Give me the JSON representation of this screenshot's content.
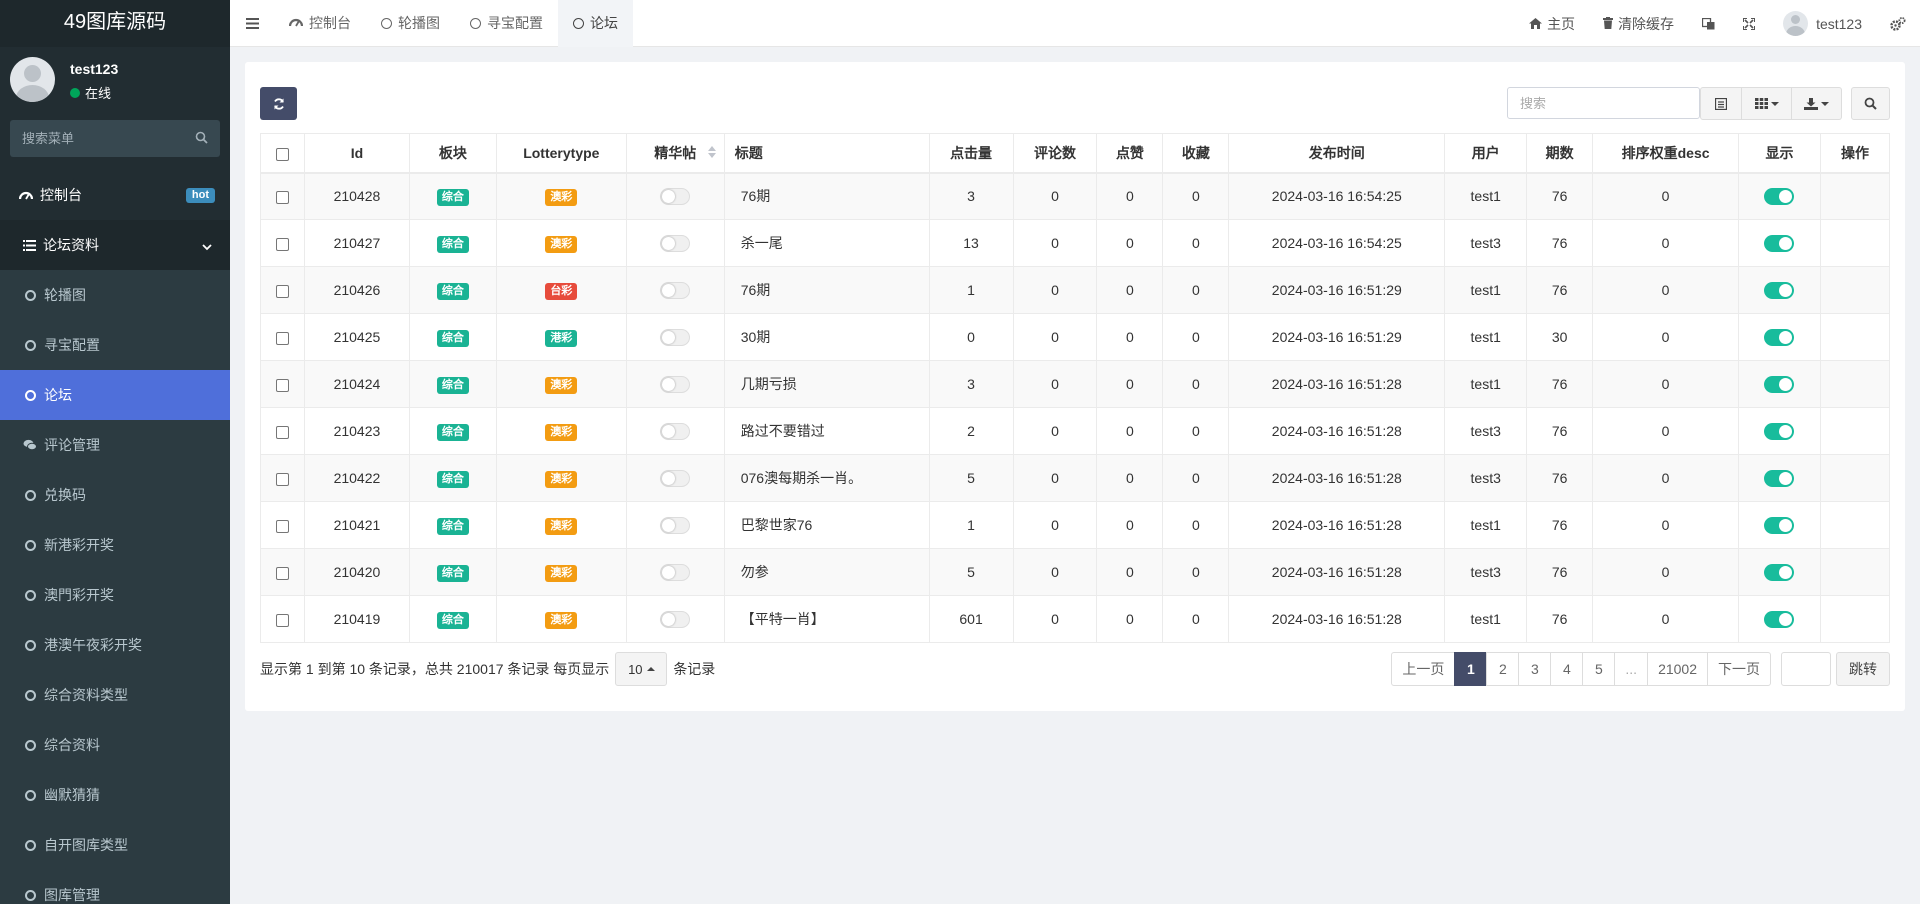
{
  "sidebar": {
    "logo": "49图库源码",
    "user_name": "test123",
    "user_status": "在线",
    "search_placeholder": "搜索菜单",
    "dashboard": "控制台",
    "hot_badge": "hot",
    "forum_group": "论坛资料",
    "items": [
      "轮播图",
      "寻宝配置",
      "论坛",
      "评论管理",
      "兑换码",
      "新港彩开奖",
      "澳門彩开奖",
      "港澳午夜彩开奖",
      "综合资料类型",
      "综合资料",
      "幽默猜猜",
      "自开图库类型",
      "图库管理"
    ],
    "active_item": "论坛"
  },
  "header": {
    "tabs": [
      "控制台",
      "轮播图",
      "寻宝配置",
      "论坛"
    ],
    "active_tab": "论坛",
    "home": "主页",
    "clear_cache": "清除缓存",
    "user": "test123"
  },
  "toolbar": {
    "search_placeholder": "搜索"
  },
  "table": {
    "columns": [
      "Id",
      "板块",
      "Lotterytype",
      "精华帖",
      "标题",
      "点击量",
      "评论数",
      "点赞",
      "收藏",
      "发布时间",
      "用户",
      "期数",
      "排序权重desc",
      "显示",
      "操作"
    ],
    "rows": [
      {
        "id": "210428",
        "section": "综合",
        "lottery": "澳彩",
        "lottery_color": "orange",
        "title": "76期",
        "clicks": "3",
        "comments": "0",
        "likes": "0",
        "favs": "0",
        "time": "2024-03-16 16:54:25",
        "user": "test1",
        "issue": "76",
        "weight": "0"
      },
      {
        "id": "210427",
        "section": "综合",
        "lottery": "澳彩",
        "lottery_color": "orange",
        "title": "杀一尾",
        "clicks": "13",
        "comments": "0",
        "likes": "0",
        "favs": "0",
        "time": "2024-03-16 16:54:25",
        "user": "test3",
        "issue": "76",
        "weight": "0"
      },
      {
        "id": "210426",
        "section": "综合",
        "lottery": "台彩",
        "lottery_color": "red",
        "title": "76期",
        "clicks": "1",
        "comments": "0",
        "likes": "0",
        "favs": "0",
        "time": "2024-03-16 16:51:29",
        "user": "test1",
        "issue": "76",
        "weight": "0"
      },
      {
        "id": "210425",
        "section": "综合",
        "lottery": "港彩",
        "lottery_color": "green",
        "title": "30期",
        "clicks": "0",
        "comments": "0",
        "likes": "0",
        "favs": "0",
        "time": "2024-03-16 16:51:29",
        "user": "test1",
        "issue": "30",
        "weight": "0"
      },
      {
        "id": "210424",
        "section": "综合",
        "lottery": "澳彩",
        "lottery_color": "orange",
        "title": "几期亏损",
        "clicks": "3",
        "comments": "0",
        "likes": "0",
        "favs": "0",
        "time": "2024-03-16 16:51:28",
        "user": "test1",
        "issue": "76",
        "weight": "0"
      },
      {
        "id": "210423",
        "section": "综合",
        "lottery": "澳彩",
        "lottery_color": "orange",
        "title": "路过不要错过",
        "clicks": "2",
        "comments": "0",
        "likes": "0",
        "favs": "0",
        "time": "2024-03-16 16:51:28",
        "user": "test3",
        "issue": "76",
        "weight": "0"
      },
      {
        "id": "210422",
        "section": "综合",
        "lottery": "澳彩",
        "lottery_color": "orange",
        "title": "076澳每期杀一肖。",
        "clicks": "5",
        "comments": "0",
        "likes": "0",
        "favs": "0",
        "time": "2024-03-16 16:51:28",
        "user": "test3",
        "issue": "76",
        "weight": "0"
      },
      {
        "id": "210421",
        "section": "综合",
        "lottery": "澳彩",
        "lottery_color": "orange",
        "title": "巴黎世家76",
        "clicks": "1",
        "comments": "0",
        "likes": "0",
        "favs": "0",
        "time": "2024-03-16 16:51:28",
        "user": "test1",
        "issue": "76",
        "weight": "0"
      },
      {
        "id": "210420",
        "section": "综合",
        "lottery": "澳彩",
        "lottery_color": "orange",
        "title": "勿参",
        "clicks": "5",
        "comments": "0",
        "likes": "0",
        "favs": "0",
        "time": "2024-03-16 16:51:28",
        "user": "test3",
        "issue": "76",
        "weight": "0"
      },
      {
        "id": "210419",
        "section": "综合",
        "lottery": "澳彩",
        "lottery_color": "orange",
        "title": "【平特一肖】",
        "clicks": "601",
        "comments": "0",
        "likes": "0",
        "favs": "0",
        "time": "2024-03-16 16:51:28",
        "user": "test1",
        "issue": "76",
        "weight": "0"
      }
    ]
  },
  "footer": {
    "info_prefix": "显示第 1 到第 10 条记录，总共 210017 条记录 每页显示",
    "page_size": "10",
    "info_suffix": "条记录"
  },
  "pagination": {
    "prev": "上一页",
    "pages": [
      "1",
      "2",
      "3",
      "4",
      "5",
      "...",
      "21002"
    ],
    "current": "1",
    "next": "下一页",
    "jump": "跳转"
  },
  "colors": {
    "sidebar_bg": "#222d32",
    "active_menu": "#4f6fda",
    "primary_btn": "#444c69",
    "label_green": "#1ab394",
    "label_orange": "#f39c12",
    "label_red": "#e74c3c",
    "switch_on": "#18bc9c"
  }
}
